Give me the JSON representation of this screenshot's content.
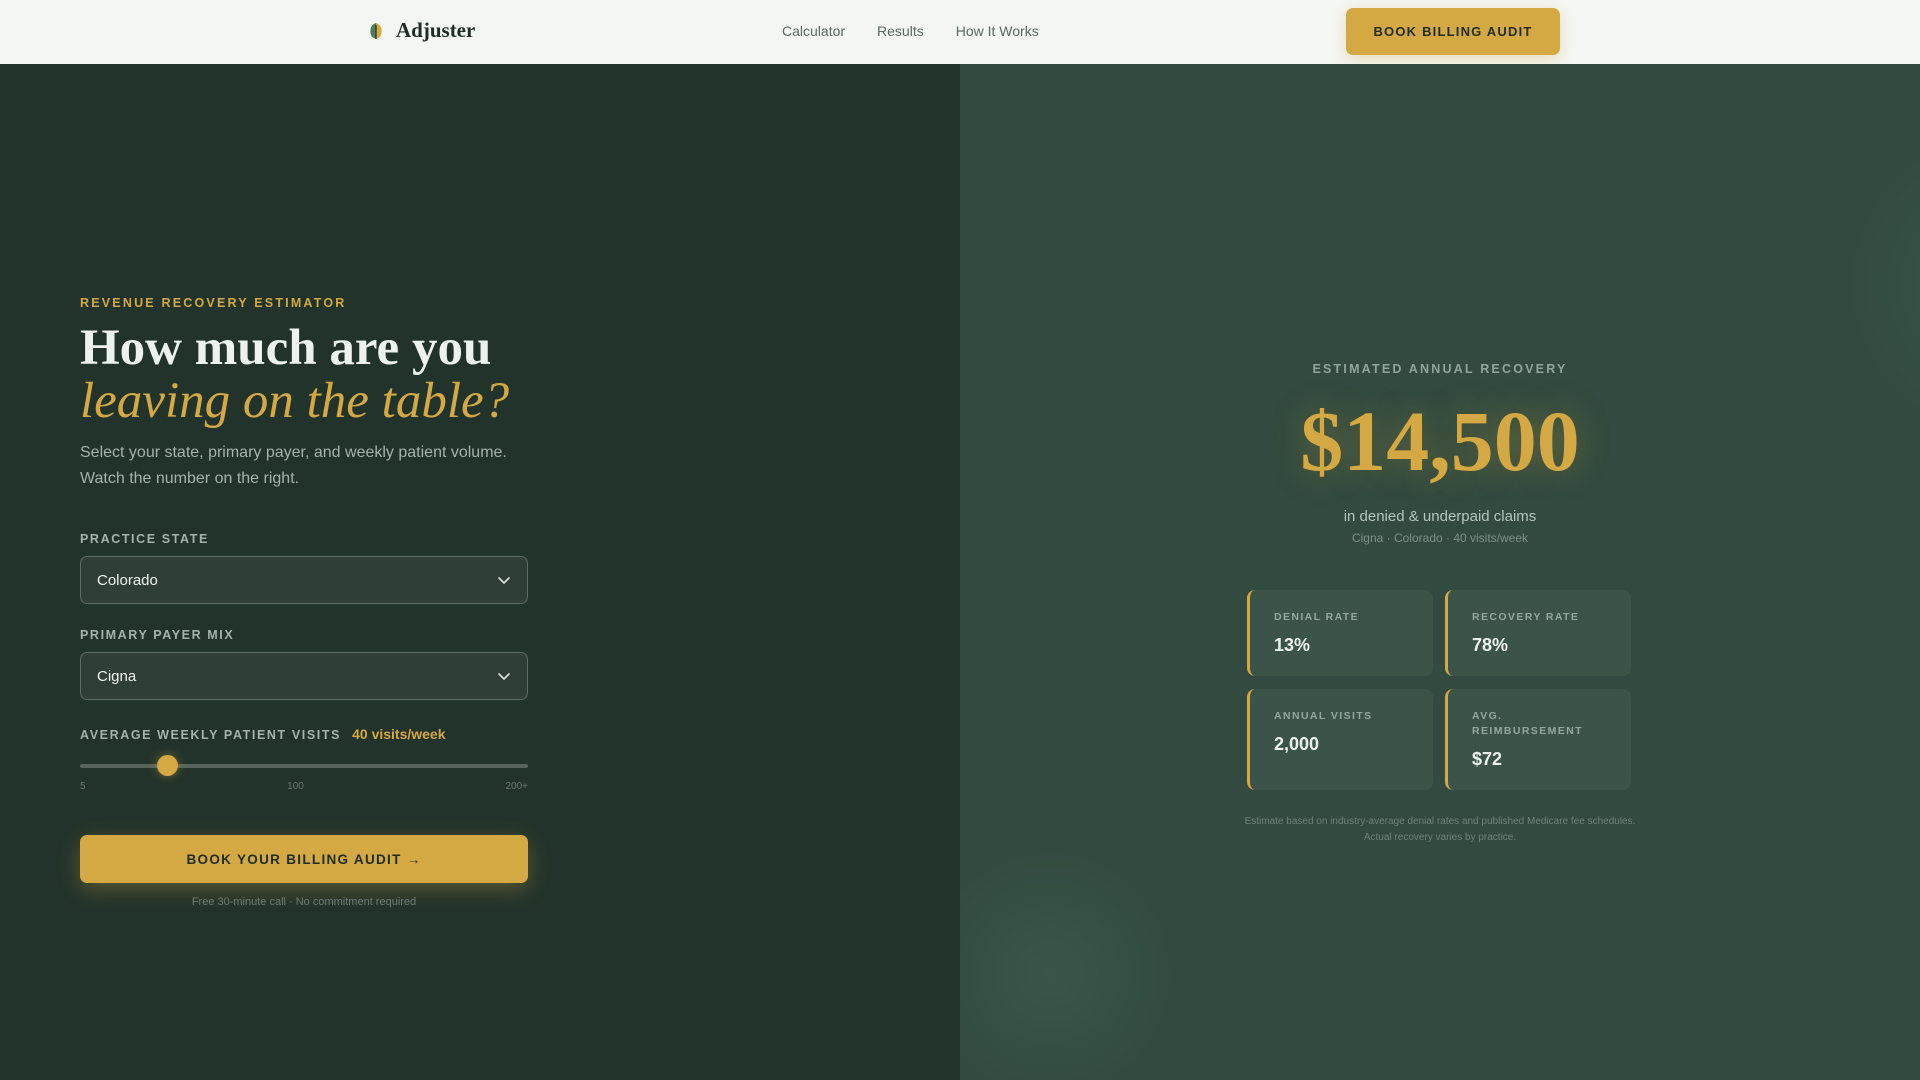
{
  "header": {
    "brand_name": "Adjuster",
    "nav": [
      "Calculator",
      "Results",
      "How It Works"
    ],
    "cta_label": "BOOK BILLING AUDIT"
  },
  "estimator": {
    "eyebrow": "REVENUE RECOVERY ESTIMATOR",
    "headline_line1": "How much are you",
    "headline_line2": "leaving on the table?",
    "subtext": "Select your state, primary payer, and weekly patient volume. Watch the number on the right.",
    "state_label": "PRACTICE STATE",
    "state_value": "Colorado",
    "payer_label": "PRIMARY PAYER MIX",
    "payer_value": "Cigna",
    "visits_label": "AVERAGE WEEKLY PATIENT VISITS",
    "visits_value": "40 visits/week",
    "slider_level": 0.195,
    "slider_ticks": [
      "5",
      "100",
      "200+"
    ],
    "cta_label": "BOOK YOUR BILLING AUDIT →",
    "cta_note": "Free 30-minute call · No commitment required"
  },
  "results": {
    "eyebrow": "ESTIMATED ANNUAL RECOVERY",
    "amount": "$14,500",
    "caption": "in denied & underpaid claims",
    "meta": "Cigna · Colorado · 40 visits/week",
    "stats": [
      {
        "label": "DENIAL RATE",
        "value": "13%"
      },
      {
        "label": "RECOVERY RATE",
        "value": "78%"
      },
      {
        "label": "ANNUAL VISITS",
        "value": "2,000"
      },
      {
        "label": "AVG. REIMBURSEMENT",
        "value": "$72"
      }
    ],
    "disclaimer": "Estimate based on industry-average denial rates and published Medicare fee schedules. Actual recovery varies by practice."
  },
  "colors": {
    "accent": "#d4a843",
    "left_bg": "#22332b",
    "right_bg": "#324a3f",
    "header_bg": "#f4f6f3"
  },
  "icons": {
    "brand": "leaf-logo-icon",
    "select": "chevron-down-icon"
  }
}
